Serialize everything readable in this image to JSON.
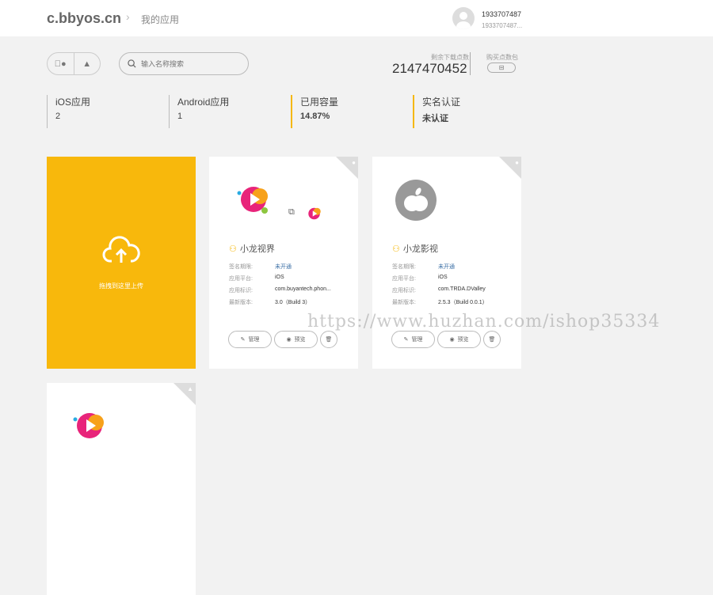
{
  "header": {
    "logo": "c.bbyos.cn",
    "crumb_sep": "›",
    "crumb": "我的应用",
    "user_name": "1933707487",
    "user_sub": "1933707487..."
  },
  "toolbar": {
    "search_placeholder": "输入名称搜索",
    "points_label": "剩余下载点数",
    "points": "2147470452",
    "buy_label": "购买点数包"
  },
  "stats": [
    {
      "label": "iOS应用",
      "value": "2"
    },
    {
      "label": "Android应用",
      "value": "1"
    },
    {
      "label": "已用容量",
      "value": "14.87%"
    },
    {
      "label": "实名认证",
      "value": "未认证"
    }
  ],
  "upload": {
    "label": "拖拽到这里上传"
  },
  "row_keys": [
    "签名期限:",
    "应用平台:",
    "应用标识:",
    "最新版本:"
  ],
  "apps": [
    {
      "name": "小龙视界",
      "sign": "未开通",
      "platform": "iOS",
      "bundle": "com.buyantech.phon...",
      "version": "3.0（Build 3）"
    },
    {
      "name": "小龙影视",
      "sign": "未开通",
      "platform": "iOS",
      "bundle": "com.TRDA.DValley",
      "version": "2.5.3（Build 0.0.1）"
    }
  ],
  "buttons": {
    "manage": "管理",
    "preview": "预览"
  },
  "watermark": "https://www.huzhan.com/ishop35334"
}
